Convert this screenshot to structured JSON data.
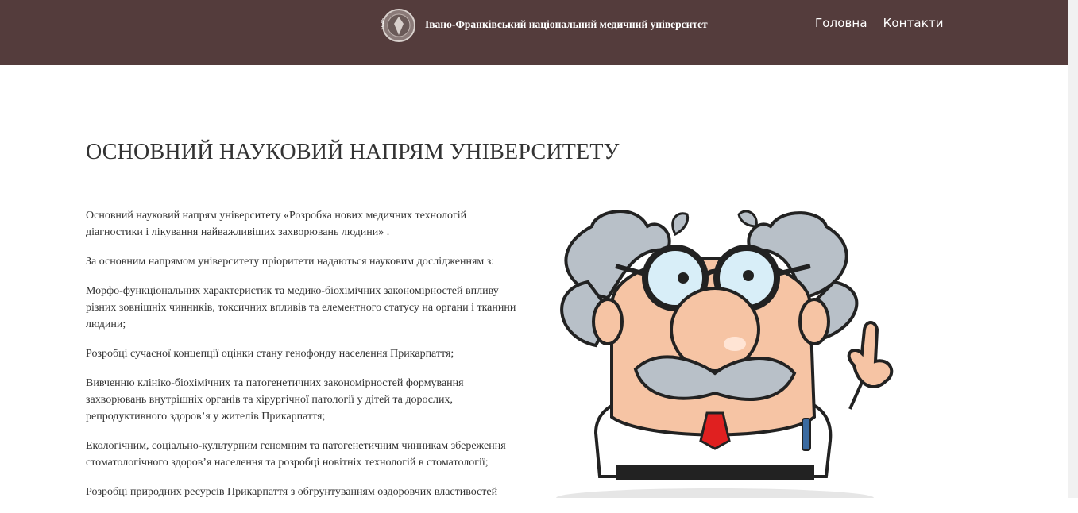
{
  "header": {
    "brand": "Івано-Франківський національний медичний університет",
    "logo_year": "1945",
    "nav": [
      {
        "label": "Головна"
      },
      {
        "label": "Контакти"
      }
    ]
  },
  "main": {
    "title": "ОСНОВНИЙ НАУКОВИЙ НАПРЯМ УНІВЕРСИТЕТУ",
    "paragraphs": [
      "Основний науковий напрям університету «Розробка нових медичних технологій діагностики і лікування найважливіших захворювань людини» .",
      "За основним напрямом університету пріоритети надаються науковим дослідженням з:",
      "Морфо-функціональних характеристик та медико-біохімічних закономірностей впливу різних зовнішніх чинників, токсичних впливів та елементного статусу на органи і тканини людини;",
      "Розробці сучасної концепції оцінки стану генофонду населення Прикарпаття;",
      "Вивченню клініко-біохімічних та патогенетичних закономірностей формування захворювань внутрішніх органів та хірургічної патології у дітей та дорослих, репродуктивного здоров’я у жителів Прикарпаття;",
      "Екологічним, соціально-культурним геномним та патогенетичним чинникам збереження стоматологічного здоров’я населення та розробці новітніх технологій в стоматології;",
      "Розробці природних ресурсів Прикарпаття з обгрунтуванням оздоровчих властивостей"
    ]
  },
  "colors": {
    "header_bg": "#543c3c",
    "header_text": "#ffffff"
  },
  "icons": {
    "logo": "university-emblem-icon",
    "illustration": "scientist-illustration"
  }
}
